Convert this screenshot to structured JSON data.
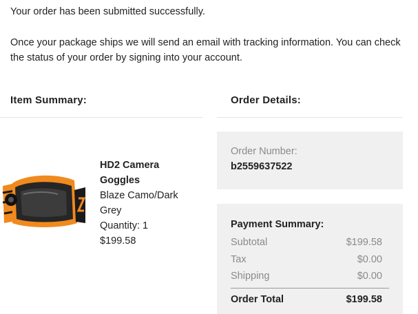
{
  "confirmation": {
    "success_message": "Your order has been submitted successfully.",
    "info_message": "Once your package ships we will send an email with tracking information. You can check the status of your order by signing into your account."
  },
  "item_summary": {
    "heading": "Item Summary:",
    "product": {
      "name": "HD2 Camera Goggles",
      "variant": "Blaze Camo/Dark Grey",
      "quantity": "Quantity: 1",
      "price": "$199.58",
      "image_icon": "camera-goggles-image"
    }
  },
  "order_details": {
    "heading": "Order Details:",
    "order_number_label": "Order Number:",
    "order_number": "b2559637522"
  },
  "payment_summary": {
    "title": "Payment Summary:",
    "rows": [
      {
        "label": "Subtotal",
        "value": "$199.58"
      },
      {
        "label": "Tax",
        "value": "$0.00"
      },
      {
        "label": "Shipping",
        "value": "$0.00"
      }
    ],
    "total_label": "Order Total",
    "total_value": "$199.58"
  },
  "colors": {
    "panel_background": "#f0f0f0",
    "muted_text": "#8a8a8a",
    "goggle_strap": "#f08a1e"
  }
}
